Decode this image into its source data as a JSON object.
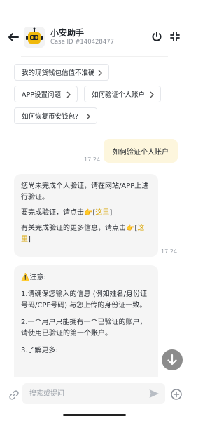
{
  "header": {
    "title": "小安助手",
    "case_id": "Case ID #140428477"
  },
  "suggestions": [
    {
      "label": "我的现货钱包估值不准确"
    },
    {
      "label": "APP设置问题"
    },
    {
      "label": "如何验证个人账户"
    },
    {
      "label": "如何恢复币安钱包?"
    }
  ],
  "messages": {
    "user": {
      "text": "如何验证个人账户",
      "time": "17:24"
    },
    "bot1": {
      "line1": "您尚未完成个人验证，请在网站/APP上进行验证。",
      "line2_prefix": "要完成验证，请点击👉[",
      "line2_link": "这里",
      "line2_suffix": "]",
      "line3_prefix": "有关完成验证的更多信息，请点击👉[",
      "line3_link": "这里",
      "line3_suffix": "]",
      "time": "17:24"
    },
    "bot2": {
      "heading": "⚠️注意:",
      "p1": "1.请确保您输入的信息 (例如姓名/身份证号码/CPF号码) 与您上传的身份证一致。",
      "p2": "2.一个用户只能拥有一个已验证的账户，请使用已验证的第一个账户。",
      "p3": "3.了解更多:"
    }
  },
  "composer": {
    "placeholder": "搜索或提问"
  },
  "colors": {
    "accent": "#f0b90b",
    "user_bubble": "#fdf6dd",
    "bot_bubble": "#f5f5f5",
    "link": "#d8a400"
  },
  "icons": [
    "back-arrow-icon",
    "robot-avatar-icon",
    "power-icon",
    "collapse-icon",
    "chevron-right-icon",
    "arrow-down-icon",
    "link-icon",
    "send-icon",
    "plus-icon"
  ]
}
